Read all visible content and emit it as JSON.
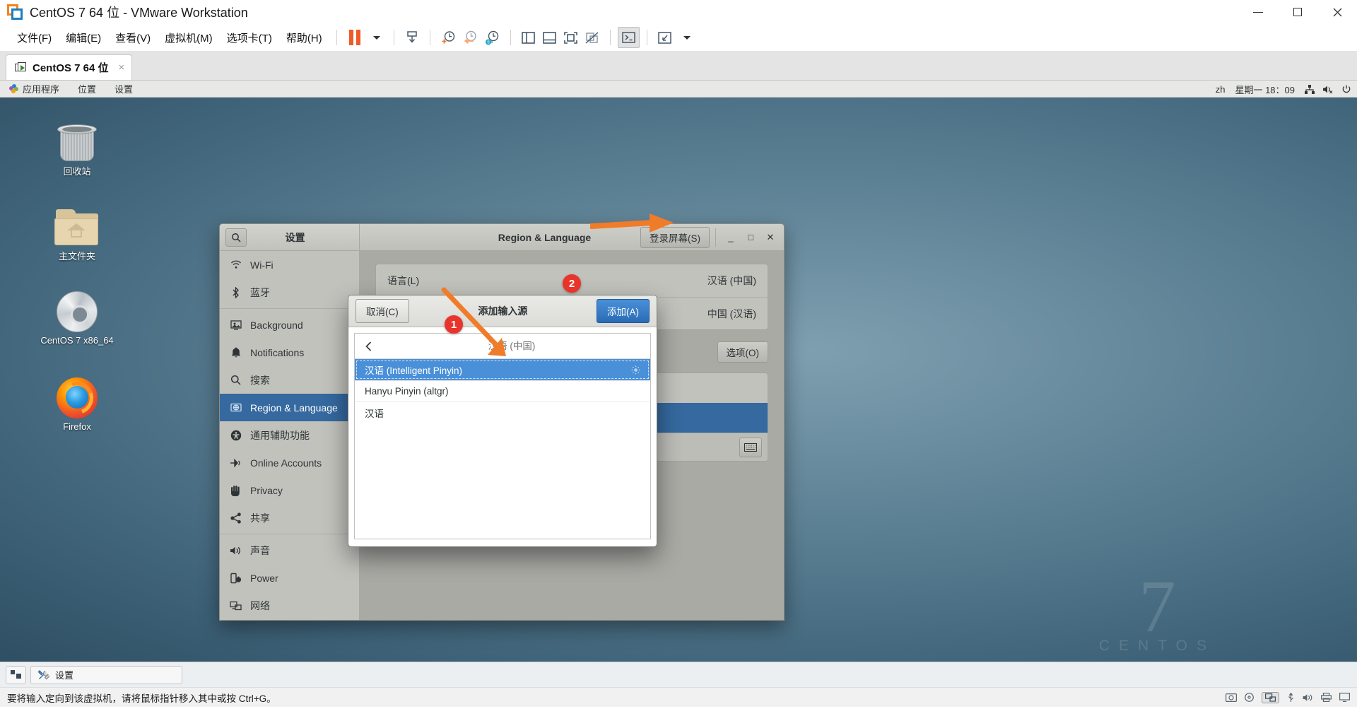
{
  "window": {
    "title": "CentOS 7 64 位 - VMware Workstation",
    "logo_icon": "vmware-logo-icon",
    "caption": {
      "minimize": "minimize-icon",
      "maximize": "maximize-icon",
      "close": "close-icon"
    }
  },
  "menubar": {
    "items": [
      {
        "label": "文件(F)",
        "mnemonic": "F"
      },
      {
        "label": "编辑(E)",
        "mnemonic": "E"
      },
      {
        "label": "查看(V)",
        "mnemonic": "V"
      },
      {
        "label": "虚拟机(M)",
        "mnemonic": "M"
      },
      {
        "label": "选项卡(T)",
        "mnemonic": "T"
      },
      {
        "label": "帮助(H)",
        "mnemonic": "H"
      }
    ],
    "toolbar": [
      {
        "name": "suspend-button",
        "icon": "pause-icon"
      },
      {
        "name": "suspend-dropdown",
        "icon": "chevron-down-icon"
      },
      {
        "name": "send-ctrl-alt-del-button",
        "icon": "send-keys-icon"
      },
      {
        "name": "take-snapshot-button",
        "icon": "snapshot-add-icon"
      },
      {
        "name": "revert-snapshot-button",
        "icon": "snapshot-revert-icon"
      },
      {
        "name": "snapshot-manager-button",
        "icon": "snapshot-manager-icon"
      },
      {
        "name": "show-library-button",
        "icon": "panel-left-icon"
      },
      {
        "name": "show-thumbnail-bar-button",
        "icon": "panel-bottom-icon"
      },
      {
        "name": "show-console-view-button",
        "icon": "console-view-icon"
      },
      {
        "name": "hide-console-view-button",
        "icon": "console-view-off-icon"
      },
      {
        "name": "unity-mode-button",
        "icon": "terminal-icon"
      },
      {
        "name": "fullscreen-button",
        "icon": "fullscreen-icon"
      },
      {
        "name": "fullscreen-dropdown",
        "icon": "chevron-down-icon"
      }
    ]
  },
  "tabs": [
    {
      "label": "CentOS 7 64 位",
      "icon": "vm-running-icon",
      "close": "×",
      "active": true
    }
  ],
  "guest": {
    "gnome_panel": {
      "left": [
        {
          "label": "应用程序",
          "icon": "applications-icon"
        },
        {
          "label": "位置",
          "icon": "places-icon"
        },
        {
          "label": "设置",
          "icon": "system-icon"
        }
      ],
      "right": {
        "input_source": "zh",
        "clock": "星期一 18：09",
        "tray": [
          {
            "name": "network-icon"
          },
          {
            "name": "volume-muted-icon"
          },
          {
            "name": "power-icon"
          }
        ]
      }
    },
    "desktop": {
      "watermark": {
        "number": "7",
        "word": "CENTOS"
      },
      "icons": [
        {
          "label": "回收站",
          "icon": "trash-icon"
        },
        {
          "label": "主文件夹",
          "icon": "home-folder-icon"
        },
        {
          "label": "CentOS 7 x86_64",
          "icon": "cd-media-icon"
        },
        {
          "label": "Firefox",
          "icon": "firefox-icon"
        }
      ]
    },
    "settings_window": {
      "sidebar_title": "设置",
      "search_icon": "search-icon",
      "header_title": "Region & Language",
      "login_screen_button": "登录屏幕(S)",
      "window_controls": {
        "minimize": "_",
        "maximize": "□",
        "close": "✕"
      },
      "sidebar_items": [
        {
          "label": "Wi-Fi",
          "icon": "wifi-icon",
          "active": false
        },
        {
          "label": "蓝牙",
          "icon": "bluetooth-icon",
          "active": false
        },
        {
          "label": "Background",
          "icon": "background-icon",
          "active": false
        },
        {
          "label": "Notifications",
          "icon": "bell-icon",
          "active": false
        },
        {
          "label": "搜索",
          "icon": "search-icon",
          "active": false
        },
        {
          "label": "Region & Language",
          "icon": "region-language-icon",
          "active": true
        },
        {
          "label": "通用辅助功能",
          "icon": "accessibility-icon",
          "active": false
        },
        {
          "label": "Online Accounts",
          "icon": "online-accounts-icon",
          "active": false
        },
        {
          "label": "Privacy",
          "icon": "privacy-hand-icon",
          "active": false
        },
        {
          "label": "共享",
          "icon": "sharing-icon",
          "active": false
        },
        {
          "label": "声音",
          "icon": "sound-icon",
          "active": false
        },
        {
          "label": "Power",
          "icon": "power-battery-icon",
          "active": false
        },
        {
          "label": "网络",
          "icon": "network-icon",
          "active": false
        }
      ],
      "content": {
        "rows": [
          {
            "label": "语言(L)",
            "value": "汉语 (中国)"
          },
          {
            "label": "",
            "value": "中国 (汉语)"
          }
        ],
        "options_button": "选项(O)",
        "keyboard_button_icon": "keyboard-icon"
      }
    },
    "dialog": {
      "title": "添加输入源",
      "cancel_button": "取消(C)",
      "add_button": "添加(A)",
      "back_icon": "chevron-left-icon",
      "search_placeholder": "汉语 (中国)",
      "items": [
        {
          "label": "汉语 (Intelligent Pinyin)",
          "selected": true,
          "gear_icon": "gear-icon"
        },
        {
          "label": "Hanyu Pinyin (altgr)",
          "selected": false
        },
        {
          "label": "汉语",
          "selected": false
        }
      ]
    },
    "annotations": [
      {
        "number": "1",
        "color": "#e8342a"
      },
      {
        "number": "2",
        "color": "#e8342a"
      }
    ]
  },
  "taskbar": {
    "restore_icon": "restore-guest-icon",
    "items": [
      {
        "label": "设置",
        "icon": "settings-tools-icon"
      }
    ]
  },
  "statusbar": {
    "message": "要将输入定向到该虚拟机，请将鼠标指针移入其中或按 Ctrl+G。",
    "icons": [
      {
        "name": "hard-disk-icon"
      },
      {
        "name": "cd-dvd-icon"
      },
      {
        "name": "network-adapter-icon"
      },
      {
        "name": "usb-icon"
      },
      {
        "name": "sound-card-icon"
      },
      {
        "name": "printer-icon"
      },
      {
        "name": "display-icon"
      }
    ]
  },
  "colors": {
    "accent_blue": "#35699f",
    "dialog_blue": "#4a90d9",
    "annotation_red": "#e8342a",
    "annotation_orange": "#f07c2a",
    "vmware_orange": "#f05a28"
  }
}
